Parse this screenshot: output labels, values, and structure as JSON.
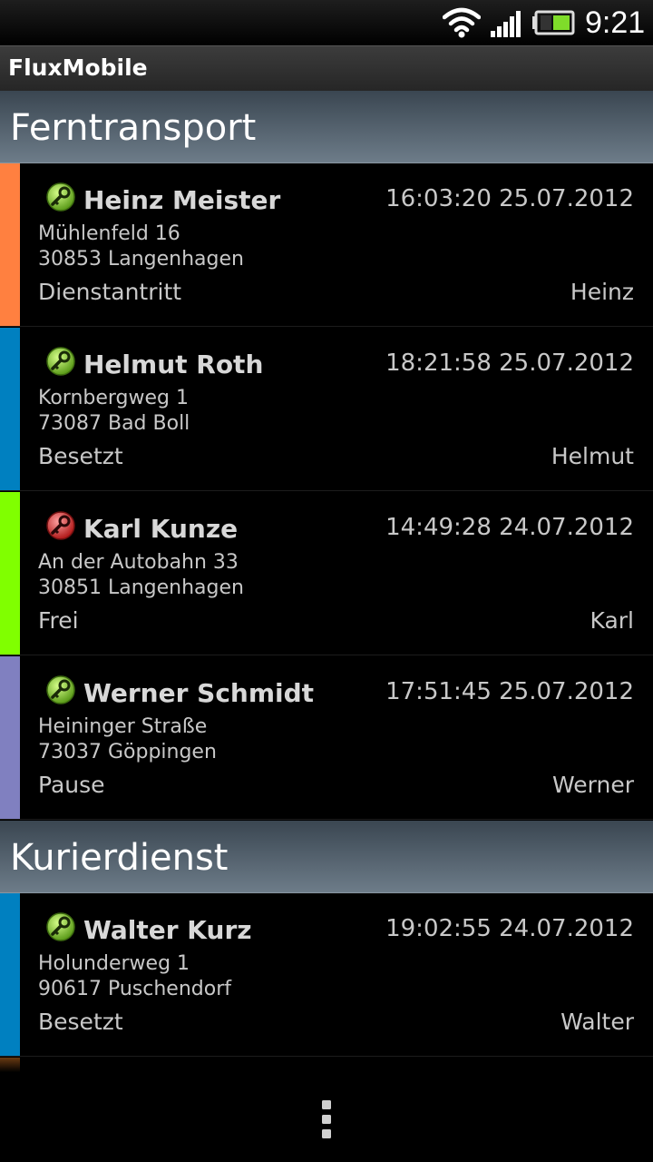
{
  "status_bar": {
    "time": "9:21",
    "icons": [
      "wifi-icon",
      "signal-icon",
      "battery-icon"
    ]
  },
  "app": {
    "title": "FluxMobile"
  },
  "sections": [
    {
      "title": "Ferntransport",
      "entries": [
        {
          "name": "Heinz Meister",
          "time": "16:03:20 25.07.2012",
          "street": "Mühlenfeld 16",
          "city": "30853 Langenhagen",
          "status": "Dienstantritt",
          "user": "Heinz",
          "color": "#ff8040",
          "key_color": "green"
        },
        {
          "name": "Helmut Roth",
          "time": "18:21:58 25.07.2012",
          "street": "Kornbergweg 1",
          "city": "73087 Bad Boll",
          "status": "Besetzt",
          "user": "Helmut",
          "color": "#0080c0",
          "key_color": "green"
        },
        {
          "name": "Karl Kunze",
          "time": "14:49:28 24.07.2012",
          "street": "An der Autobahn 33",
          "city": "30851 Langenhagen",
          "status": "Frei",
          "user": "Karl",
          "color": "#80ff00",
          "key_color": "red"
        },
        {
          "name": "Werner Schmidt",
          "time": "17:51:45 25.07.2012",
          "street": "Heininger Straße",
          "city": "73037 Göppingen",
          "status": "Pause",
          "user": "Werner",
          "color": "#8080c0",
          "key_color": "green"
        }
      ]
    },
    {
      "title": "Kurierdienst",
      "entries": [
        {
          "name": "Walter Kurz",
          "time": "19:02:55 24.07.2012",
          "street": "Holunderweg 1",
          "city": "90617 Puschendorf",
          "status": "Besetzt",
          "user": "Walter",
          "color": "#0080c0",
          "key_color": "green"
        }
      ]
    }
  ],
  "bottom_bar": {
    "icons": [
      "menu-overflow-icon"
    ]
  },
  "colors": {
    "key_green": "#8fd63a",
    "key_red": "#e04040",
    "header_top": "#3a4651",
    "header_bottom": "#6d7c89"
  }
}
